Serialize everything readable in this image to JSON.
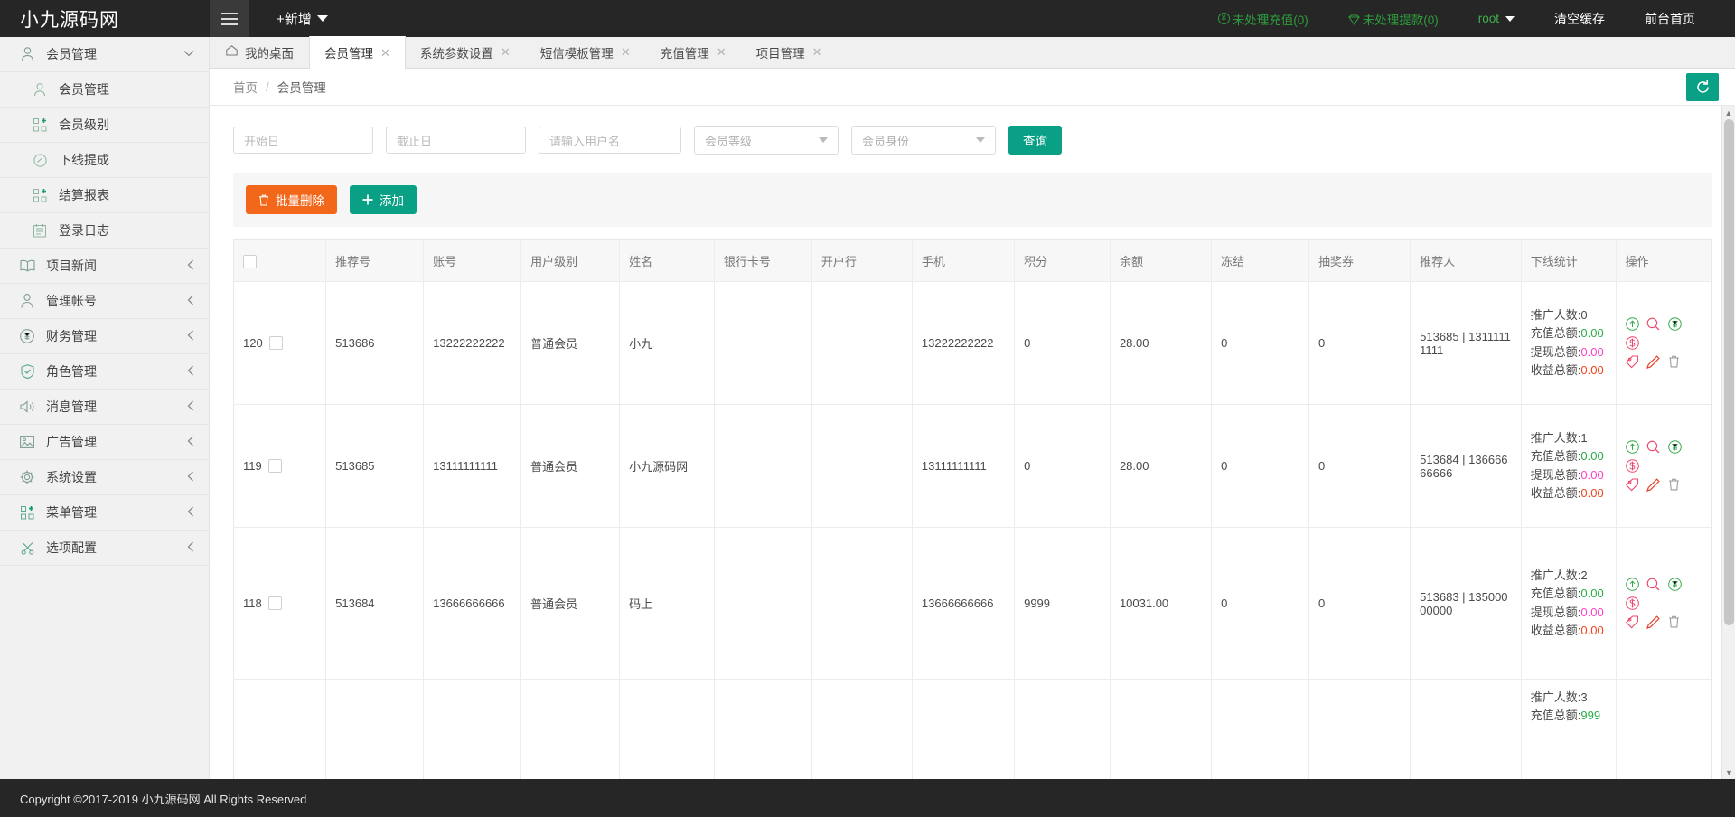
{
  "app": {
    "logo_text": "小九源码网",
    "new_button": "+新增"
  },
  "header": {
    "pending_recharge": "未处理充值(0)",
    "pending_withdraw": "未处理提款(0)",
    "user": "root",
    "clear_cache": "清空缓存",
    "front_home": "前台首页"
  },
  "sidebar": {
    "items": [
      {
        "label": "会员管理",
        "icon": "user-icon",
        "chevron": "▾",
        "level": "parent"
      },
      {
        "label": "会员管理",
        "icon": "user-icon",
        "chevron": "",
        "level": "child"
      },
      {
        "label": "会员级别",
        "icon": "grid-plus-icon",
        "chevron": "",
        "level": "child"
      },
      {
        "label": "下线提成",
        "icon": "gauge-icon",
        "chevron": "",
        "level": "child"
      },
      {
        "label": "结算报表",
        "icon": "grid-plus-icon",
        "chevron": "",
        "level": "child"
      },
      {
        "label": "登录日志",
        "icon": "list-doc-icon",
        "chevron": "",
        "level": "child"
      },
      {
        "label": "项目新闻",
        "icon": "book-icon",
        "chevron": "‹",
        "level": "parent"
      },
      {
        "label": "管理帐号",
        "icon": "user-circle-icon",
        "chevron": "‹",
        "level": "parent"
      },
      {
        "label": "财务管理",
        "icon": "yen-circle-icon",
        "chevron": "‹",
        "level": "parent"
      },
      {
        "label": "角色管理",
        "icon": "shield-check-icon",
        "chevron": "‹",
        "level": "parent"
      },
      {
        "label": "消息管理",
        "icon": "speaker-icon",
        "chevron": "‹",
        "level": "parent"
      },
      {
        "label": "广告管理",
        "icon": "image-icon",
        "chevron": "‹",
        "level": "parent"
      },
      {
        "label": "系统设置",
        "icon": "gear-icon",
        "chevron": "‹",
        "level": "parent"
      },
      {
        "label": "菜单管理",
        "icon": "grid-plus-icon",
        "chevron": "‹",
        "level": "parent"
      },
      {
        "label": "选项配置",
        "icon": "scissors-icon",
        "chevron": "‹",
        "level": "parent"
      }
    ]
  },
  "tabs": [
    {
      "label": "我的桌面",
      "closable": false,
      "active": false
    },
    {
      "label": "会员管理",
      "closable": true,
      "active": true
    },
    {
      "label": "系统参数设置",
      "closable": true,
      "active": false
    },
    {
      "label": "短信模板管理",
      "closable": true,
      "active": false
    },
    {
      "label": "充值管理",
      "closable": true,
      "active": false
    },
    {
      "label": "项目管理",
      "closable": true,
      "active": false
    }
  ],
  "breadcrumb": {
    "home": "首页",
    "separator": "/",
    "current": "会员管理"
  },
  "filters": {
    "start_date": "开始日",
    "end_date": "截止日",
    "username": "请输入用户名",
    "member_level": "会员等级",
    "member_identity": "会员身份",
    "query_button": "查询"
  },
  "toolbar": {
    "batch_delete": "批量删除",
    "add": "添加"
  },
  "table": {
    "columns": [
      "",
      "推荐号",
      "账号",
      "用户级别",
      "姓名",
      "银行卡号",
      "开户行",
      "手机",
      "积分",
      "余额",
      "冻结",
      "抽奖券",
      "推荐人",
      "下线统计",
      "操作"
    ],
    "stat_labels": {
      "promo_count": "推广人数:",
      "recharge_total": "充值总额:",
      "withdraw_total": "提现总额:",
      "income_total": "收益总额:"
    },
    "rows": [
      {
        "id": "120",
        "referral_no": "513686",
        "account": "13222222222",
        "level": "普通会员",
        "name": "小九",
        "bank_card": "",
        "bank_name": "",
        "mobile": "13222222222",
        "points": "0",
        "balance": "28.00",
        "frozen": "0",
        "lottery": "0",
        "referrer": "513685 | 13111111111",
        "stats": {
          "promo_count": "0",
          "recharge_total": "0.00",
          "withdraw_total": "0.00",
          "income_total": "0.00"
        }
      },
      {
        "id": "119",
        "referral_no": "513685",
        "account": "13111111111",
        "level": "普通会员",
        "name": "小九源码网",
        "bank_card": "",
        "bank_name": "",
        "mobile": "13111111111",
        "points": "0",
        "balance": "28.00",
        "frozen": "0",
        "lottery": "0",
        "referrer": "513684 | 13666666666",
        "stats": {
          "promo_count": "1",
          "recharge_total": "0.00",
          "withdraw_total": "0.00",
          "income_total": "0.00"
        }
      },
      {
        "id": "118",
        "referral_no": "513684",
        "account": "13666666666",
        "level": "普通会员",
        "name": "码上",
        "bank_card": "",
        "bank_name": "",
        "mobile": "13666666666",
        "points": "9999",
        "balance": "10031.00",
        "frozen": "0",
        "lottery": "0",
        "referrer": "513683 | 13500000000",
        "stats": {
          "promo_count": "2",
          "recharge_total": "0.00",
          "withdraw_total": "0.00",
          "income_total": "0.00"
        }
      },
      {
        "id": "",
        "referral_no": "",
        "account": "",
        "level": "",
        "name": "",
        "bank_card": "",
        "bank_name": "",
        "mobile": "",
        "points": "",
        "balance": "",
        "frozen": "",
        "lottery": "",
        "referrer": "",
        "stats": {
          "promo_count": "3",
          "recharge_total": "999",
          "withdraw_total": "",
          "income_total": ""
        }
      }
    ],
    "action_icons": [
      "arrow-up-circle-icon",
      "search-circle-icon",
      "yen-circle-icon",
      "dollar-circle-icon",
      "tag-icon",
      "pencil-icon",
      "trash-icon"
    ]
  },
  "footer": {
    "copyright": "Copyright ©2017-2019 小九源码网 All Rights Reserved"
  },
  "colors": {
    "brand_teal": "#0aa086",
    "orange": "#f2671a",
    "dark": "#262626",
    "green_stat": "#27ae45",
    "pink_stat": "#ff3fc8",
    "red_stat": "#f4421b"
  }
}
